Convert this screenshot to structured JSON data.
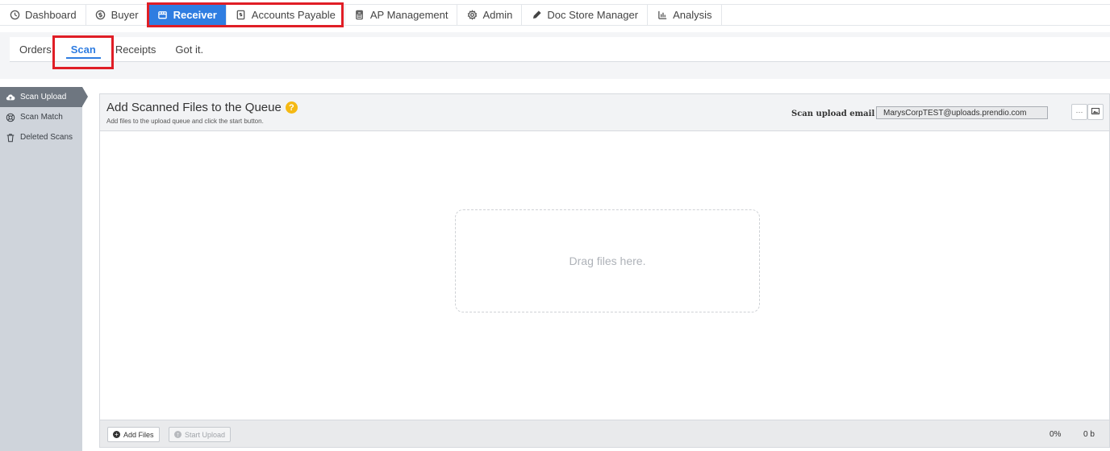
{
  "topnav": {
    "items": [
      {
        "label": "Dashboard",
        "icon": "dashboard-icon"
      },
      {
        "label": "Buyer",
        "icon": "dollar-circle-icon"
      },
      {
        "label": "Receiver",
        "icon": "receiver-box-icon",
        "active": true
      },
      {
        "label": "Accounts Payable",
        "icon": "invoice-icon"
      },
      {
        "label": "AP Management",
        "icon": "calculator-icon"
      },
      {
        "label": "Admin",
        "icon": "gear-icon"
      },
      {
        "label": "Doc Store Manager",
        "icon": "pen-icon"
      },
      {
        "label": "Analysis",
        "icon": "bar-chart-icon"
      }
    ]
  },
  "subtabs": {
    "items": [
      {
        "label": "Orders"
      },
      {
        "label": "Scan",
        "active": true
      },
      {
        "label": "Receipts"
      },
      {
        "label": "Got it."
      }
    ]
  },
  "sidebar": {
    "items": [
      {
        "label": "Scan Upload",
        "icon": "cloud-upload-icon",
        "active": true
      },
      {
        "label": "Scan Match",
        "icon": "lifebuoy-icon"
      },
      {
        "label": "Deleted Scans",
        "icon": "trash-icon"
      }
    ]
  },
  "panel": {
    "title": "Add Scanned Files to the Queue",
    "help_glyph": "?",
    "subtitle": "Add files to the upload queue and click the start button.",
    "email_label": "Scan upload email",
    "email_value": "MarysCorpTEST@uploads.prendio.com",
    "more_glyph": "···",
    "dropzone_text": "Drag files here.",
    "add_files_label": "Add Files",
    "start_upload_label": "Start Upload",
    "percent": "0%",
    "bytes": "0 b"
  },
  "colors": {
    "accent": "#2f7de1",
    "highlight_box": "#e01e26",
    "sidebar_bg": "#cfd4db",
    "sidebar_active": "#6e7680",
    "help_icon": "#f5b914"
  }
}
